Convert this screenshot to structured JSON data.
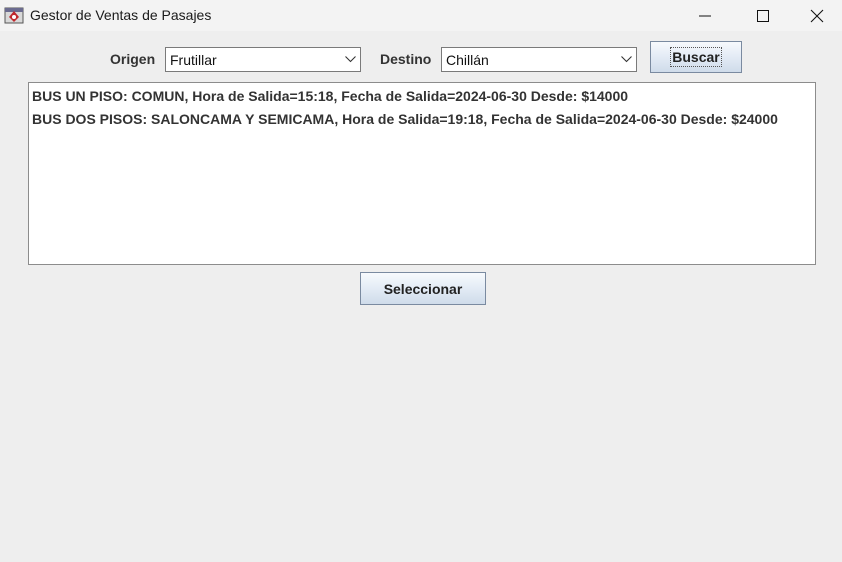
{
  "window": {
    "title": "Gestor de Ventas de Pasajes",
    "icons": {
      "app": "java-app-icon",
      "minimize": "minimize-icon",
      "maximize": "maximize-icon",
      "close": "close-icon"
    }
  },
  "search": {
    "origen_label": "Origen",
    "origen_value": "Frutillar",
    "destino_label": "Destino",
    "destino_value": "Chillán",
    "buscar_label": "Buscar"
  },
  "results": [
    {
      "text": "BUS UN PISO: COMUN, Hora de Salida=15:18, Fecha de Salida=2024-06-30 Desde: $14000"
    },
    {
      "text": "BUS DOS PISOS: SALONCAMA Y SEMICAMA, Hora de Salida=19:18, Fecha de Salida=2024-06-30 Desde: $24000"
    }
  ],
  "actions": {
    "seleccionar_label": "Seleccionar"
  }
}
